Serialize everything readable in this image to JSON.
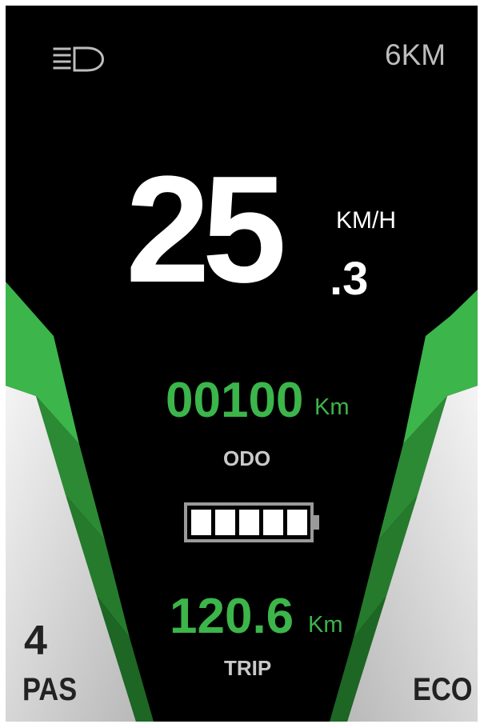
{
  "status_bar": {
    "headlight_icon": "headlight-icon",
    "range": "6KM"
  },
  "speed": {
    "integer": "25",
    "decimal": ".3",
    "unit": "KM/H"
  },
  "odo": {
    "value": "00100",
    "unit": "Km",
    "label": "ODO"
  },
  "battery": {
    "icon": "battery-icon",
    "bars_filled": 5,
    "bars_total": 5
  },
  "trip": {
    "value": "120.6",
    "unit": "Km",
    "label": "TRIP"
  },
  "assist": {
    "level": "4",
    "label": "PAS",
    "level_fraction": 0.8
  },
  "mode": {
    "label": "ECO"
  },
  "colors": {
    "background": "#000000",
    "accent_green": "#3cb54a",
    "dark_green_1": "#2c8a34",
    "dark_green_2": "#257a2c",
    "dark_green_3": "#1d6624",
    "silver_panel": "#d9d9d9",
    "secondary_text": "#bdbdbd"
  }
}
